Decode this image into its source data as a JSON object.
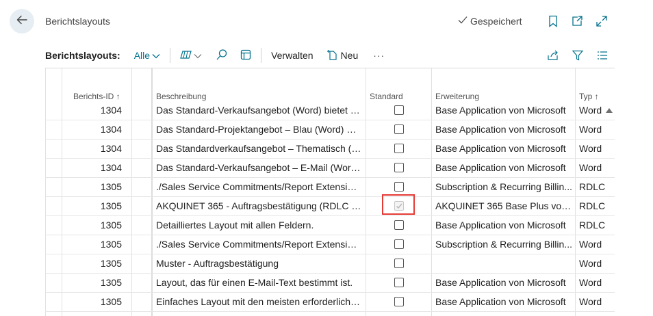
{
  "header": {
    "title": "Berichtslayouts",
    "saved_status": "Gespeichert"
  },
  "toolbar": {
    "label": "Berichtslayouts:",
    "filter": "Alle",
    "manage": "Verwalten",
    "new": "Neu",
    "more": "···"
  },
  "columns": {
    "id": "Berichts-ID ↑",
    "description": "Beschreibung",
    "default": "Standard",
    "extension": "Erweiterung",
    "type": "Typ ↑"
  },
  "rows": [
    {
      "id": "1304",
      "description": "Das Standard-Verkaufsangebot (Word) bietet ei...",
      "default": false,
      "extension": "Base Application von Microsoft",
      "type": "Word"
    },
    {
      "id": "1304",
      "description": "Das Standard-Projektangebot – Blau (Word) bie...",
      "default": false,
      "extension": "Base Application von Microsoft",
      "type": "Word"
    },
    {
      "id": "1304",
      "description": "Das Standardverkaufsangebot – Thematisch (W...",
      "default": false,
      "extension": "Base Application von Microsoft",
      "type": "Word"
    },
    {
      "id": "1304",
      "description": "Das Standard-Verkaufsangebot – E-Mail (Word)...",
      "default": false,
      "extension": "Base Application von Microsoft",
      "type": "Word"
    },
    {
      "id": "1305",
      "description": "./Sales Service Commitments/Report Extension...",
      "default": false,
      "extension": "Subscription & Recurring Billin...",
      "type": "RDLC"
    },
    {
      "id": "1305",
      "description": "AKQUINET 365 - Auftragsbestätigung (RDLC v1)",
      "default": true,
      "extension": "AKQUINET 365 Base Plus von ...",
      "type": "RDLC"
    },
    {
      "id": "1305",
      "description": "Detailliertes Layout mit allen Feldern.",
      "default": false,
      "extension": "Base Application von Microsoft",
      "type": "RDLC"
    },
    {
      "id": "1305",
      "description": "./Sales Service Commitments/Report Extension...",
      "default": false,
      "extension": "Subscription & Recurring Billin...",
      "type": "Word"
    },
    {
      "id": "1305",
      "description": "Muster - Auftragsbestätigung",
      "default": false,
      "extension": "",
      "type": "Word"
    },
    {
      "id": "1305",
      "description": "Layout, das für einen E-Mail-Text bestimmt ist.",
      "default": false,
      "extension": "Base Application von Microsoft",
      "type": "Word"
    },
    {
      "id": "1305",
      "description": "Einfaches Layout mit den meisten erforderliche...",
      "default": false,
      "extension": "Base Application von Microsoft",
      "type": "Word"
    }
  ],
  "colors": {
    "accent": "#00708c",
    "highlight": "#e53935"
  }
}
